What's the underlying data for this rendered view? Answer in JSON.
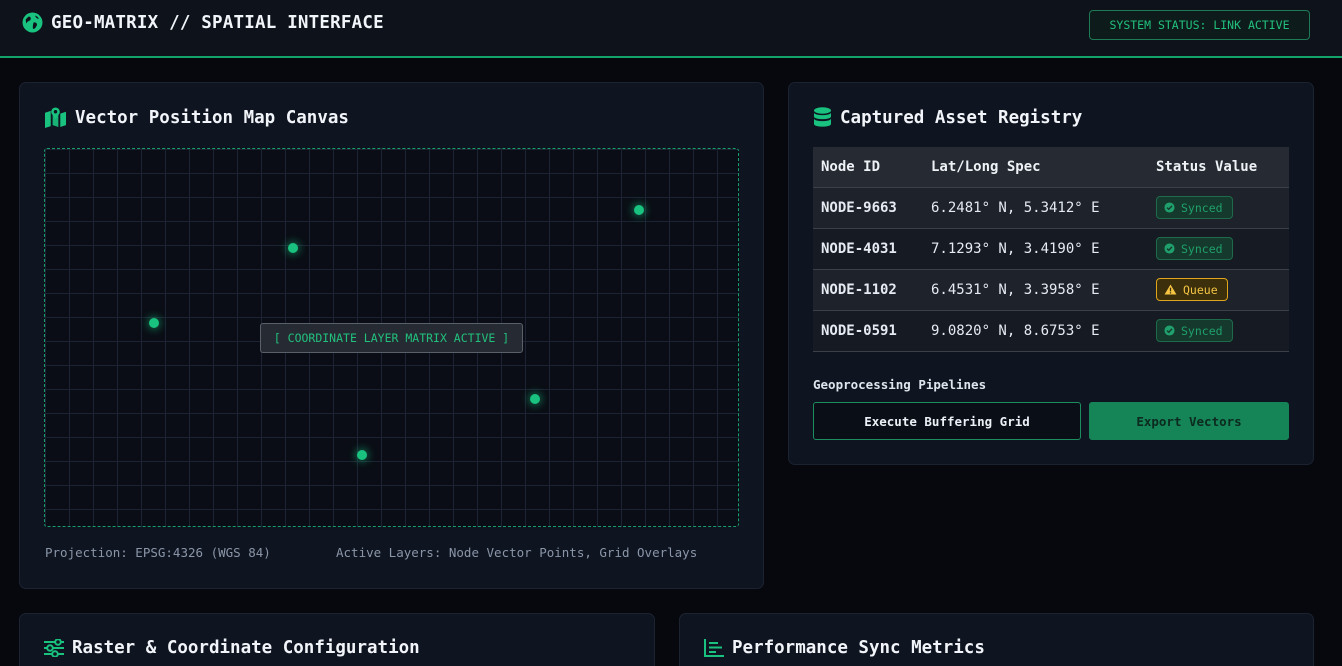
{
  "header": {
    "title": "GEO-MATRIX // SPATIAL INTERFACE",
    "icon": "globe-icon",
    "status": "SYSTEM STATUS: LINK ACTIVE"
  },
  "map_panel": {
    "title": "Vector Position Map Canvas",
    "icon": "map-marked-icon",
    "overlay_label": "[ COORDINATE LAYER MATRIX ACTIVE ]",
    "projection": "Projection: EPSG:4326 (WGS 84)",
    "active_layers": "Active Layers: Node Vector Points, Grid Overlays",
    "node_count": 5
  },
  "registry_panel": {
    "title": "Captured Asset Registry",
    "icon": "database-icon",
    "columns": [
      "Node ID",
      "Lat/Long Spec",
      "Status Value"
    ],
    "rows": [
      {
        "id": "NODE-9663",
        "coords": "6.2481° N, 5.3412° E",
        "status": "Synced",
        "status_type": "synced"
      },
      {
        "id": "NODE-4031",
        "coords": "7.1293° N, 3.4190° E",
        "status": "Synced",
        "status_type": "synced"
      },
      {
        "id": "NODE-1102",
        "coords": "6.4531° N, 3.3958° E",
        "status": "Queue",
        "status_type": "queue"
      },
      {
        "id": "NODE-0591",
        "coords": "9.0820° N, 8.6753° E",
        "status": "Synced",
        "status_type": "synced"
      }
    ],
    "pipelines_label": "Geoprocessing Pipelines",
    "buttons": {
      "buffer": "Execute Buffering Grid",
      "export": "Export Vectors"
    }
  },
  "config_panel": {
    "title": "Raster & Coordinate Configuration",
    "icon": "sliders-icon"
  },
  "metrics_panel": {
    "title": "Performance Sync Metrics",
    "icon": "chart-bar-icon"
  },
  "colors": {
    "accent": "#19c27f",
    "warning": "#f5c443",
    "background": "#06080e",
    "panel": "#0e1420"
  }
}
